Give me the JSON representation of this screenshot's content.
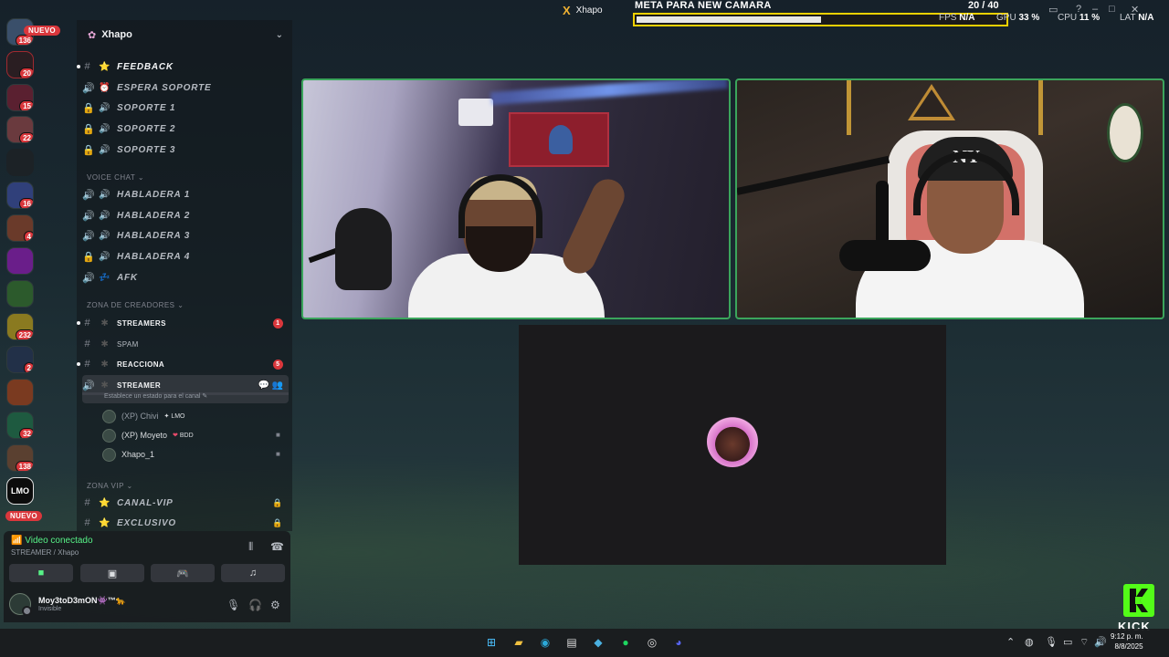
{
  "server": {
    "name": "Xhapo"
  },
  "rail": {
    "new_label": "NUEVO",
    "new_label_bottom": "NUEVO",
    "badges": [
      "136",
      "20",
      "15",
      "22",
      "16",
      "4",
      "232",
      "2",
      "32",
      "138"
    ],
    "lmo_label": "LMO"
  },
  "channels": [
    {
      "type": "text",
      "emoji": "⭐",
      "name": "FEEDBACK",
      "unread": true
    },
    {
      "type": "voice",
      "emoji": "⏰",
      "name": "ESPERA SOPORTE"
    },
    {
      "type": "voice-locked",
      "emoji": "🔊",
      "name": "SOPORTE 1"
    },
    {
      "type": "voice-locked",
      "emoji": "🔊",
      "name": "SOPORTE 2"
    },
    {
      "type": "voice-locked",
      "emoji": "🔊",
      "name": "SOPORTE 3"
    }
  ],
  "categories": {
    "voice_chat": "VOICE CHAT",
    "zona_creadores": "ZONA DE CREADORES",
    "zona_vip": "ZONA VIP"
  },
  "voice_channels": [
    {
      "name": "HABLADERA 1"
    },
    {
      "name": "HABLADERA 2"
    },
    {
      "name": "HABLADERA 3"
    },
    {
      "name": "HABLADERA 4"
    },
    {
      "name": "AFK"
    }
  ],
  "creator_channels": [
    {
      "name": "STREAMERS",
      "count": "1"
    },
    {
      "name": "SPAM"
    },
    {
      "name": "REACCIONA",
      "count": "5"
    },
    {
      "name": "STREAMER",
      "sub": "Establece un estado para el canal"
    }
  ],
  "voice_users": [
    {
      "name": "(XP) Chivi",
      "tag": "LMO"
    },
    {
      "name": "(XP) Moyeto",
      "tag": "BDD"
    },
    {
      "name": "Xhapo_1"
    }
  ],
  "vip_channels": [
    {
      "name": "CANAL-VIP"
    },
    {
      "name": "EXCLUSIVO"
    }
  ],
  "voice_panel": {
    "status": "Video conectado",
    "channel": "STREAMER / Xhapo"
  },
  "user": {
    "name": "Moy3toD3mON👾™🐆",
    "status": "Invisible"
  },
  "overlay": {
    "top_app": "Xhapo",
    "goal_title": "META PARA NEW CAMARA",
    "goal_count": "20  / 40",
    "goal_progress": 0.5,
    "fps_label": "FPS",
    "fps_value": "N/A",
    "gpu_label": "GPU",
    "gpu_value": "33 %",
    "cpu_label": "CPU",
    "cpu_value": "11 %",
    "lat_label": "LAT",
    "lat_value": "N/A",
    "kick": "KICK"
  },
  "video": {
    "cap_logo": "NY"
  },
  "taskbar": {
    "time": "9:12 p. m.",
    "date": "8/8/2025"
  },
  "colors": {
    "accent_green": "#3ba55c",
    "goal_border": "#f0d000",
    "badge_red": "#da373c",
    "kick_green": "#53fc18"
  }
}
